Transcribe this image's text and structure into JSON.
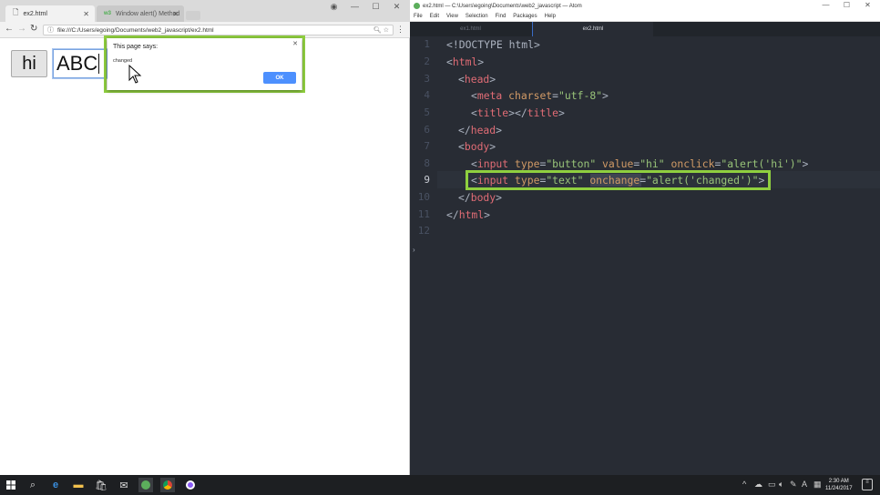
{
  "browser": {
    "tabs": [
      {
        "label": "ex2.html",
        "icon": "page-icon",
        "active": true
      },
      {
        "label": "Window alert() Method",
        "icon": "w3-icon",
        "active": false
      }
    ],
    "url": "file:///C:/Users/egoing/Documents/web2_javascript/ex2.html",
    "page": {
      "button_value": "hi",
      "text_value": "ABC"
    },
    "alert": {
      "title": "This page says:",
      "message": "changed",
      "ok_label": "OK"
    }
  },
  "editor": {
    "title": "ex2.html — C:\\Users\\egoing\\Documents\\web2_javascript — Atom",
    "menu": [
      "File",
      "Edit",
      "View",
      "Selection",
      "Find",
      "Packages",
      "Help"
    ],
    "tabs": [
      {
        "label": "ex1.html",
        "active": false
      },
      {
        "label": "ex2.html",
        "active": true
      }
    ],
    "line_numbers": [
      "1",
      "2",
      "3",
      "4",
      "5",
      "6",
      "7",
      "8",
      "9",
      "10",
      "11",
      "12"
    ],
    "active_line": 9
  },
  "taskbar": {
    "clock_time": "2:30 AM",
    "clock_date": "11/24/2017"
  },
  "colors": {
    "highlight_green": "#8fcf3f",
    "editor_bg": "#282c34",
    "tag_red": "#e06c75",
    "attr_orange": "#d19a66",
    "string_green": "#98c379",
    "ok_blue": "#4d90fe"
  }
}
